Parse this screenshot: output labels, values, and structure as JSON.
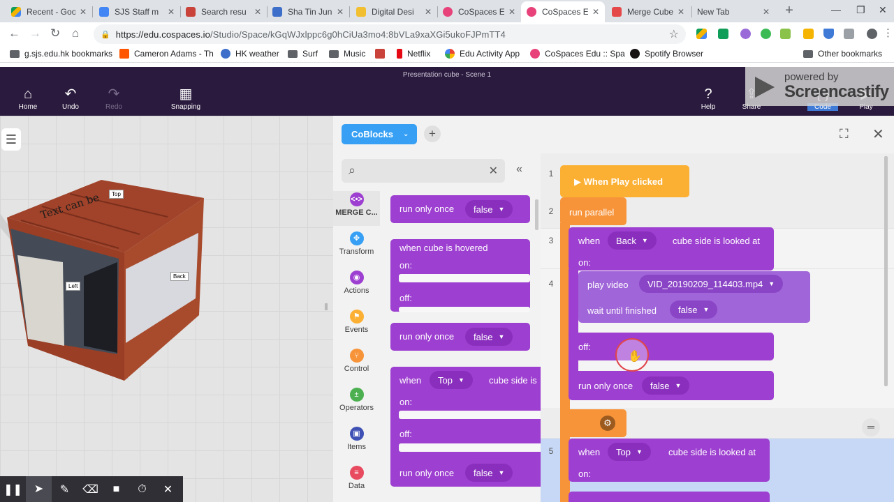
{
  "browser": {
    "tabs": [
      {
        "title": "Recent - Goo",
        "color": "#4a8af4"
      },
      {
        "title": "SJS Staff m",
        "color": "#4285f4"
      },
      {
        "title": "Search resu",
        "color": "#c9433a"
      },
      {
        "title": "Sha Tin Jun",
        "color": "#3d6ec9"
      },
      {
        "title": "Digital Desi",
        "color": "#f2bf31"
      },
      {
        "title": "CoSpaces E",
        "color": "#e8427a"
      },
      {
        "title": "CoSpaces E",
        "color": "#e8427a"
      },
      {
        "title": "Merge Cube",
        "color": "#e54848"
      },
      {
        "title": "New Tab",
        "color": "#ffffff"
      }
    ],
    "url_host": "https://edu.cospaces.io",
    "url_path": "/Studio/Space/kGqWJxlppc6g0hCiUa3mo4:8bVLa9xaXGi5ukoFJPmTT4",
    "bookmarks": [
      {
        "label": "g.sjs.edu.hk bookmarks",
        "icon": "folder-icon"
      },
      {
        "label": "Cameron Adams - Th",
        "icon": "soundcloud-icon"
      },
      {
        "label": "HK weather",
        "icon": "weather-icon"
      },
      {
        "label": "Surf",
        "icon": "folder-icon"
      },
      {
        "label": "Music",
        "icon": "folder-icon"
      },
      {
        "label": "",
        "icon": "gmail-icon"
      },
      {
        "label": "Netflix",
        "icon": "netflix-icon"
      },
      {
        "label": "Edu Activity App",
        "icon": "google-icon"
      },
      {
        "label": "CoSpaces Edu :: Spa",
        "icon": "cospaces-icon"
      },
      {
        "label": "Spotify Browser",
        "icon": "spotify-icon"
      },
      {
        "label": "Other bookmarks",
        "icon": "folder-icon"
      }
    ]
  },
  "header": {
    "scene_title": "Presentation cube - Scene 1",
    "home": "Home",
    "undo": "Undo",
    "redo": "Redo",
    "snapping": "Snapping",
    "help": "Help",
    "share": "Share",
    "code": "Code",
    "play": "Play",
    "watermark_powered": "powered by",
    "watermark_brand": "Screencastify"
  },
  "viewport": {
    "labels": {
      "top": "Top",
      "left": "Left",
      "back": "Back"
    }
  },
  "editor": {
    "coblocks_label": "CoBlocks",
    "categories": [
      {
        "label": "MERGE C...",
        "color": "#9d3fd0",
        "glyph": "<•>"
      },
      {
        "label": "Transform",
        "color": "#37a0f4",
        "glyph": "✥"
      },
      {
        "label": "Actions",
        "color": "#9d3fd0",
        "glyph": "◉"
      },
      {
        "label": "Events",
        "color": "#fbb033",
        "glyph": "⚑"
      },
      {
        "label": "Control",
        "color": "#f7943a",
        "glyph": "⑂"
      },
      {
        "label": "Operators",
        "color": "#4caf50",
        "glyph": "±"
      },
      {
        "label": "Items",
        "color": "#3f51b5",
        "glyph": "▣"
      },
      {
        "label": "Data",
        "color": "#e84a5f",
        "glyph": "≡"
      }
    ],
    "palette": {
      "run_only_once": "run only once",
      "false_val": "false",
      "when_cube_hovered": "when cube is hovered",
      "on": "on:",
      "off": "off:",
      "when": "when",
      "top": "Top",
      "cube_side_is": "cube side is"
    },
    "code": {
      "rows": [
        "1",
        "2",
        "3",
        "4",
        "5"
      ],
      "when_play_clicked": "When Play clicked",
      "run_parallel": "run parallel",
      "when": "when",
      "side_back": "Back",
      "side_top": "Top",
      "cube_side_looked_at": "cube side is looked at",
      "on": "on:",
      "off": "off:",
      "play_video": "play video",
      "video_file": "VID_20190209_114403.mp4",
      "wait_until_finished": "wait until finished",
      "false_val": "false",
      "run_only_once": "run only once"
    }
  }
}
